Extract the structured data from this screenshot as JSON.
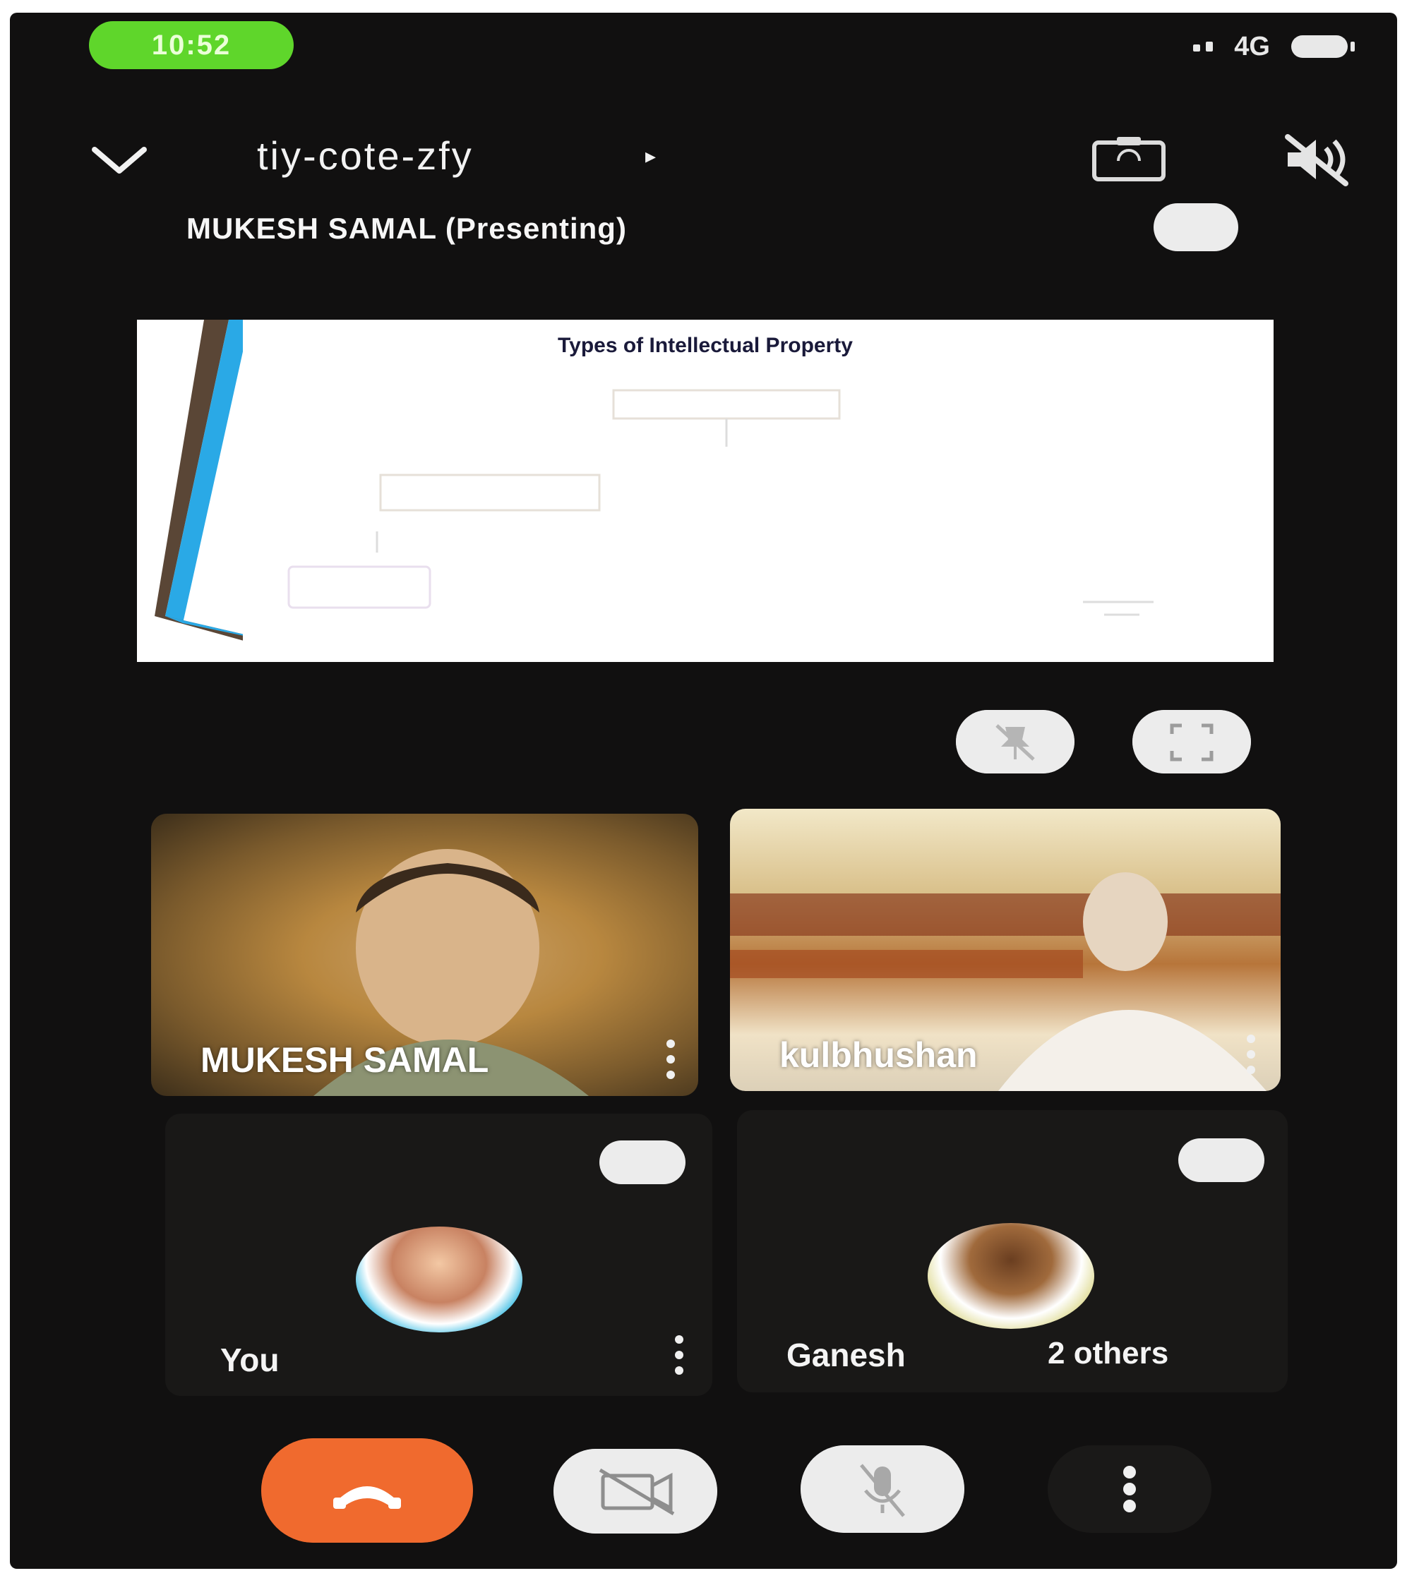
{
  "status_bar": {
    "time": "10:52",
    "network": "4G"
  },
  "top_bar": {
    "meeting_code": "tiy-cote-zfy",
    "arrow": "▸"
  },
  "presentation": {
    "presenter_label": "MUKESH SAMAL (Presenting)",
    "slide_title": "Types of Intellectual Property"
  },
  "participants": [
    {
      "name": "MUKESH SAMAL"
    },
    {
      "name": "kulbhushan"
    },
    {
      "name": "You"
    },
    {
      "name": "Ganesh",
      "others": "2 others"
    }
  ],
  "colors": {
    "background": "#111010",
    "end_call": "#f06a2e",
    "clock_pill": "#5fd62b",
    "control_button": "#ececec"
  },
  "icons": {
    "chevron": "chevron-down-icon",
    "camera_switch": "camera-switch-icon",
    "audio": "audio-off-icon",
    "pin": "pin-off-icon",
    "fullscreen": "fullscreen-icon",
    "end_call": "phone-hangup-icon",
    "camera_toggle": "camera-off-icon",
    "mic_toggle": "mic-off-icon",
    "more": "more-vertical-icon"
  }
}
